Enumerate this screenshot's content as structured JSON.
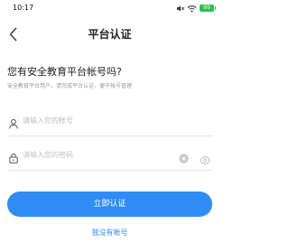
{
  "status_bar": {
    "time": "10:17",
    "battery_level": "99",
    "icons": [
      "mute-icon",
      "wifi-icon",
      "battery-icon"
    ]
  },
  "nav": {
    "title": "平台认证",
    "back_icon": "chevron-left-icon"
  },
  "content": {
    "heading": "您有安全教育平台帐号吗?",
    "subheading": "安全教育平台用户，请完成平台认证，便于帐号管理"
  },
  "form": {
    "account": {
      "placeholder": "请输入您的帐号",
      "icon": "user-icon"
    },
    "password": {
      "placeholder": "请输入您的密码",
      "icon": "lock-icon",
      "clear_icon": "clear-icon",
      "visibility_icon": "eye-icon"
    }
  },
  "actions": {
    "submit_label": "立即认证",
    "no_account_label": "我没有帐号"
  },
  "colors": {
    "accent": "#2f8cf5",
    "battery": "#2fbf4f",
    "placeholder": "#bfbfbf",
    "subtext": "#999999"
  }
}
